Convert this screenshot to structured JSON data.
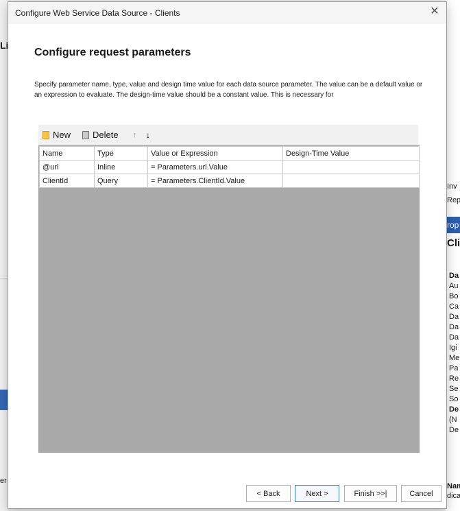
{
  "background": {
    "left_fragments": [
      "Li",
      "er"
    ],
    "right_fragments": [
      "Inv",
      "Repo",
      "rop",
      "Clie",
      "Da",
      "Au",
      "Bo",
      "Ca",
      "Da",
      "Da",
      "Da",
      "Igi",
      "Me",
      "Pa",
      "Re",
      "Se",
      "So",
      "De",
      "(N",
      "De",
      "Nam",
      "dica"
    ]
  },
  "dialog": {
    "title": "Configure Web Service Data Source - Clients",
    "heading": "Configure request parameters",
    "description": "Specify parameter name, type, value and design time value for each data source parameter. The value can be a default value or an expression to evaluate. The design-time value should be a constant value. This is necessary for"
  },
  "toolbar": {
    "new_label": "New",
    "delete_label": "Delete",
    "move_up": "↑",
    "move_down": "↓"
  },
  "grid": {
    "columns": [
      "Name",
      "Type",
      "Value or Expression",
      "Design-Time Value"
    ],
    "rows": [
      [
        "@url",
        "Inline",
        "= Parameters.url.Value",
        ""
      ],
      [
        "ClientId",
        "Query",
        "= Parameters.ClientId.Value",
        ""
      ]
    ]
  },
  "buttons": {
    "back": "< Back",
    "next": "Next >",
    "finish": "Finish >>|",
    "cancel": "Cancel"
  },
  "colors": {
    "accent": "#3c7fd1",
    "grid_empty": "#a9a9a9"
  }
}
